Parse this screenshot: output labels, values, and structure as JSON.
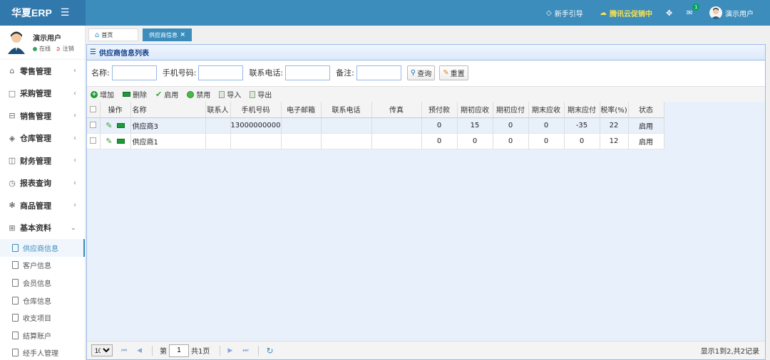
{
  "app": {
    "brand": "华夏ERP"
  },
  "topbar": {
    "guide_label": "新手引导",
    "promo_label": "腾讯云促销中",
    "mail_badge": "1",
    "user_label": "演示用户"
  },
  "sidebar": {
    "user_name": "演示用户",
    "online_label": "在线",
    "logout_label": "注销",
    "menu": [
      {
        "label": "零售管理",
        "icon": "shop-icon"
      },
      {
        "label": "采购管理",
        "icon": "monitor-icon"
      },
      {
        "label": "销售管理",
        "icon": "briefcase-icon"
      },
      {
        "label": "仓库管理",
        "icon": "layers-icon"
      },
      {
        "label": "财务管理",
        "icon": "book-icon"
      },
      {
        "label": "报表查询",
        "icon": "clock-icon"
      },
      {
        "label": "商品管理",
        "icon": "gift-icon"
      },
      {
        "label": "基本资料",
        "icon": "grid-icon"
      }
    ],
    "submenu": [
      {
        "label": "供应商信息",
        "active": true
      },
      {
        "label": "客户信息"
      },
      {
        "label": "会员信息"
      },
      {
        "label": "仓库信息"
      },
      {
        "label": "收支项目"
      },
      {
        "label": "结算账户"
      },
      {
        "label": "经手人管理"
      }
    ]
  },
  "tabs": {
    "home": "首页",
    "current": "供应商信息"
  },
  "panel": {
    "title": "供应商信息列表"
  },
  "search": {
    "name_label": "名称:",
    "phone_label": "手机号码:",
    "tel_label": "联系电话:",
    "remark_label": "备注:",
    "name_value": "",
    "phone_value": "",
    "tel_value": "",
    "remark_value": "",
    "query_label": "查询",
    "reset_label": "重置"
  },
  "toolbar": {
    "add": "增加",
    "delete": "删除",
    "enable": "启用",
    "disable": "禁用",
    "import": "导入",
    "export": "导出"
  },
  "table": {
    "headers": [
      "操作",
      "名称",
      "联系人",
      "手机号码",
      "电子邮箱",
      "联系电话",
      "传真",
      "预付款",
      "期初应收",
      "期初应付",
      "期末应收",
      "期末应付",
      "税率(%)",
      "状态"
    ],
    "rows": [
      {
        "name": "供应商3",
        "contact": "",
        "phone": "13000000000",
        "email": "",
        "tel": "",
        "fax": "",
        "prepay": "0",
        "init_recv": "15",
        "init_pay": "0",
        "end_recv": "0",
        "end_pay": "-35",
        "tax": "22",
        "status": "启用"
      },
      {
        "name": "供应商1",
        "contact": "",
        "phone": "",
        "email": "",
        "tel": "",
        "fax": "",
        "prepay": "0",
        "init_recv": "0",
        "init_pay": "0",
        "end_recv": "0",
        "end_pay": "0",
        "tax": "12",
        "status": "启用"
      }
    ]
  },
  "pager": {
    "page_size": "10",
    "page_prefix": "第",
    "page_value": "1",
    "page_total": "共1页",
    "info": "显示1到2,共2记录"
  },
  "colors": {
    "topbar": "#3c8dbc",
    "logo_bg": "#3178ad",
    "promo": "#ffe24a"
  }
}
